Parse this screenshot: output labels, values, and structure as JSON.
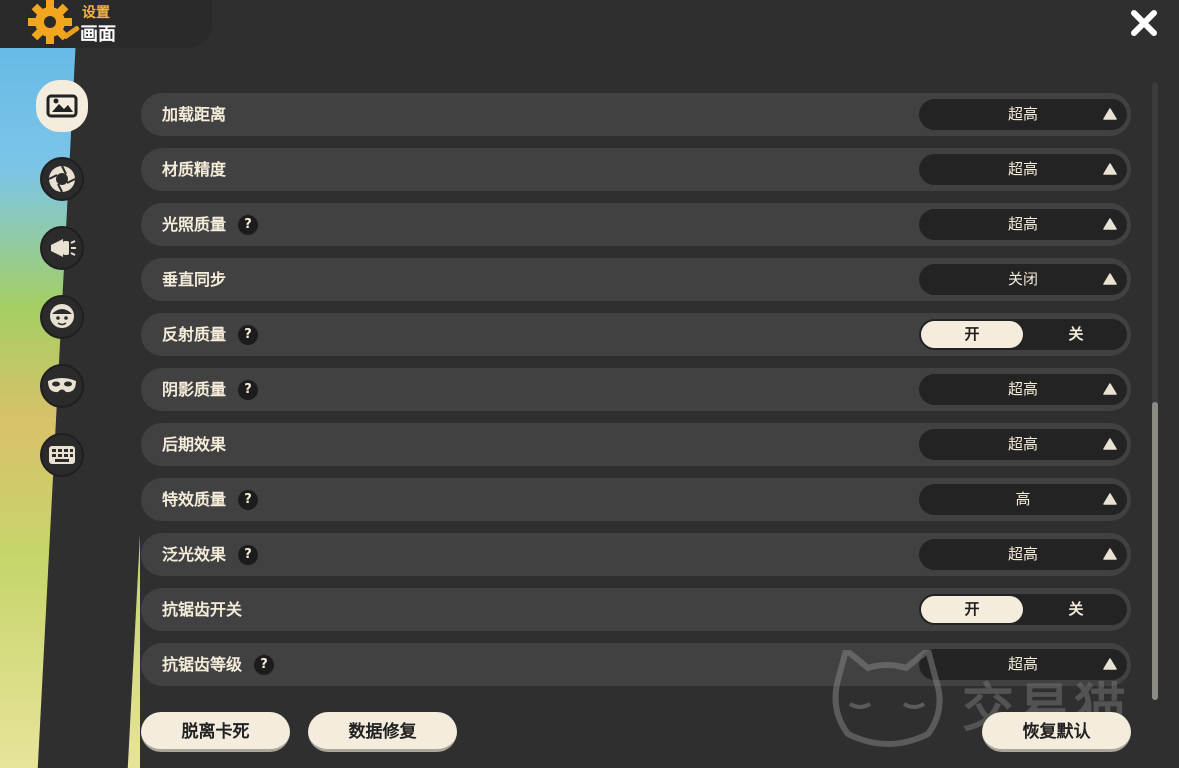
{
  "header": {
    "section": "设置",
    "page": "画面"
  },
  "nav": [
    "display-icon",
    "aperture-icon",
    "megaphone-icon",
    "avatar-icon",
    "mask-icon",
    "keyboard-icon"
  ],
  "settings": [
    {
      "label": "加载距离",
      "help": false,
      "type": "select",
      "value": "超高"
    },
    {
      "label": "材质精度",
      "help": false,
      "type": "select",
      "value": "超高"
    },
    {
      "label": "光照质量",
      "help": true,
      "type": "select",
      "value": "超高"
    },
    {
      "label": "垂直同步",
      "help": false,
      "type": "select",
      "value": "关闭"
    },
    {
      "label": "反射质量",
      "help": true,
      "type": "toggle",
      "on_label": "开",
      "off_label": "关",
      "state": "on"
    },
    {
      "label": "阴影质量",
      "help": true,
      "type": "select",
      "value": "超高"
    },
    {
      "label": "后期效果",
      "help": false,
      "type": "select",
      "value": "超高"
    },
    {
      "label": "特效质量",
      "help": true,
      "type": "select",
      "value": "高"
    },
    {
      "label": "泛光效果",
      "help": true,
      "type": "select",
      "value": "超高"
    },
    {
      "label": "抗锯齿开关",
      "help": false,
      "type": "toggle",
      "on_label": "开",
      "off_label": "关",
      "state": "on"
    },
    {
      "label": "抗锯齿等级",
      "help": true,
      "type": "select",
      "value": "超高"
    }
  ],
  "help_glyph": "?",
  "buttons": {
    "escape": "脱离卡死",
    "repair": "数据修复",
    "restore": "恢复默认"
  },
  "watermark": "交易猫",
  "colors": {
    "accent": "#f2b540",
    "panel": "#2f2f30",
    "row": "#414142",
    "cream": "#f4ecdc"
  }
}
